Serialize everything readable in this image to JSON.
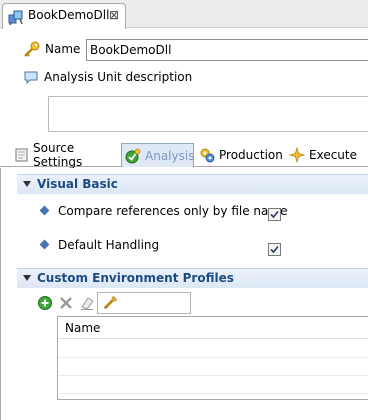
{
  "editor_tab": {
    "title": "BookDemoDll",
    "close": "⊠",
    "icon": "analysis-unit-icon"
  },
  "name_field": {
    "label": "Name",
    "value": "BookDemoDll",
    "icon": "key-icon"
  },
  "description": {
    "label": "Analysis Unit description",
    "value": "",
    "icon": "comment-icon"
  },
  "tabs": [
    {
      "label": "Source Settings",
      "icon": "source-settings-icon",
      "active": false
    },
    {
      "label": "Analysis",
      "icon": "analysis-icon",
      "active": true
    },
    {
      "label": "Production",
      "icon": "production-icon",
      "active": false
    },
    {
      "label": "Execute",
      "icon": "execute-icon",
      "active": false
    }
  ],
  "visual_basic": {
    "title": "Visual Basic",
    "options": [
      {
        "label": "Compare references only by file name",
        "checked": true
      },
      {
        "label": "Default Handling",
        "checked": true
      }
    ]
  },
  "custom_env": {
    "title": "Custom Environment Profiles",
    "toolbar": [
      "add-icon",
      "delete-icon",
      "clear-icon",
      "edit-icon"
    ],
    "filter_value": "",
    "table": {
      "columns": [
        "Name"
      ],
      "rows": []
    }
  },
  "colors": {
    "accent": "#1f4b82",
    "active_tab_bg": "#dfe9f6",
    "section_header": "#dde8f5",
    "diamond": "#4976b3",
    "add_icon": "#3fa535"
  }
}
